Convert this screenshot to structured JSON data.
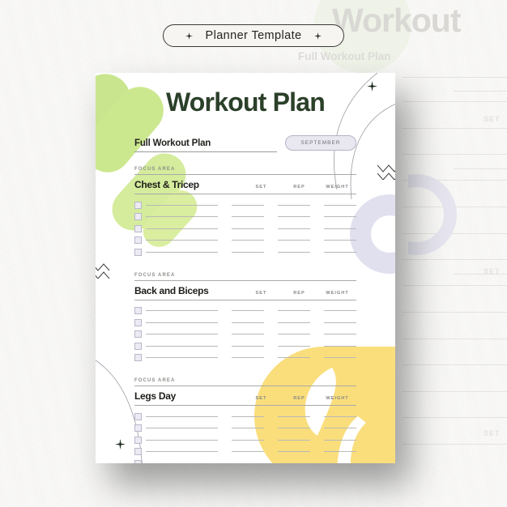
{
  "badge": {
    "label": "Planner Template",
    "left_icon": "sparkle-icon",
    "right_icon": "sparkle-icon"
  },
  "background": {
    "ghost_title": "Workout",
    "ghost_subtitle": "Full Workout Plan",
    "ghost_words": [
      "SET",
      "SET",
      "SET"
    ]
  },
  "sheet": {
    "title": "Workout Plan",
    "subtitle": "Full Workout Plan",
    "month": "SEPTEMBER",
    "focus_label": "FOCUS AREA",
    "columns": [
      "SET",
      "REP",
      "WEIGHT"
    ],
    "sections": [
      {
        "focus_label": "FOCUS AREA",
        "name": "Chest & Tricep",
        "columns": [
          "SET",
          "REP",
          "WEIGHT"
        ],
        "rows": [
          "",
          "",
          "",
          "",
          ""
        ]
      },
      {
        "focus_label": "FOCUS AREA",
        "name": "Back and Biceps",
        "columns": [
          "SET",
          "REP",
          "WEIGHT"
        ],
        "rows": [
          "",
          "",
          "",
          "",
          ""
        ]
      },
      {
        "focus_label": "FOCUS AREA",
        "name": "Legs Day",
        "columns": [
          "SET",
          "REP",
          "WEIGHT"
        ],
        "rows": [
          "",
          "",
          "",
          "",
          ""
        ]
      }
    ]
  },
  "colors": {
    "title_green": "#2b4029",
    "accent_green": "#cce88f",
    "accent_yellow": "#fade7c",
    "accent_lavender": "#e1e0ef",
    "paper": "#ffffff",
    "backdrop": "#f3f2ef",
    "rule": "#a9a9a6"
  }
}
